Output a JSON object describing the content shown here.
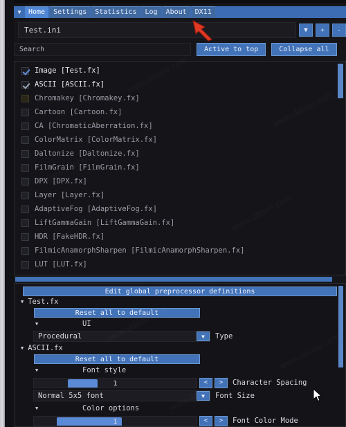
{
  "tabs": {
    "caret_icon": "chevron-down-icon",
    "items": [
      {
        "label": "Home",
        "active": true
      },
      {
        "label": "Settings",
        "active": false
      },
      {
        "label": "Statistics",
        "active": false
      },
      {
        "label": "Log",
        "active": false
      },
      {
        "label": "About",
        "active": false
      },
      {
        "label": "DX11",
        "active": false
      }
    ]
  },
  "preset": {
    "value": "Test.ini",
    "dropdown_icon": "chevron-down-icon",
    "add_label": "+",
    "remove_label": "-"
  },
  "search": {
    "placeholder": "Search",
    "value": "",
    "active_to_top_label": "Active to top",
    "collapse_all_label": "Collapse all"
  },
  "technique_list": {
    "items": [
      {
        "label": "Image [Test.fx]",
        "checked": true,
        "enabled": true,
        "swatch": "none"
      },
      {
        "label": "ASCII [ASCII.fx]",
        "checked": true,
        "enabled": true,
        "swatch": "dim"
      },
      {
        "label": "Chromakey [Chromakey.fx]",
        "checked": false,
        "enabled": false,
        "swatch": "olive"
      },
      {
        "label": "Cartoon [Cartoon.fx]",
        "checked": false,
        "enabled": false,
        "swatch": "none"
      },
      {
        "label": "CA [ChromaticAberration.fx]",
        "checked": false,
        "enabled": false,
        "swatch": "none"
      },
      {
        "label": "ColorMatrix [ColorMatrix.fx]",
        "checked": false,
        "enabled": false,
        "swatch": "none"
      },
      {
        "label": "Daltonize [Daltonize.fx]",
        "checked": false,
        "enabled": false,
        "swatch": "none"
      },
      {
        "label": "FilmGrain [FilmGrain.fx]",
        "checked": false,
        "enabled": false,
        "swatch": "none"
      },
      {
        "label": "DPX [DPX.fx]",
        "checked": false,
        "enabled": false,
        "swatch": "none"
      },
      {
        "label": "Layer [Layer.fx]",
        "checked": false,
        "enabled": false,
        "swatch": "none"
      },
      {
        "label": "AdaptiveFog [AdaptiveFog.fx]",
        "checked": false,
        "enabled": false,
        "swatch": "none"
      },
      {
        "label": "LiftGammaGain [LiftGammaGain.fx]",
        "checked": false,
        "enabled": false,
        "swatch": "none"
      },
      {
        "label": "HDR [FakeHDR.fx]",
        "checked": false,
        "enabled": false,
        "swatch": "none"
      },
      {
        "label": "FilmicAnamorphSharpen [FilmicAnamorphSharpen.fx]",
        "checked": false,
        "enabled": false,
        "swatch": "none"
      },
      {
        "label": "LUT [LUT.fx]",
        "checked": false,
        "enabled": false,
        "swatch": "none"
      }
    ]
  },
  "settings_panel": {
    "global_button_label": "Edit global preprocessor definitions",
    "sections": [
      {
        "title": "Test.fx",
        "caret_icon": "caret-down-icon",
        "reset_label": "Reset all to default",
        "group_label": "UI",
        "group_caret_icon": "caret-down-icon",
        "combo_value": "Procedural",
        "combo_label": "Type",
        "combo_arrow_icon": "chevron-down-icon"
      },
      {
        "title": "ASCII.fx",
        "caret_icon": "caret-down-icon",
        "reset_label": "Reset all to default",
        "group_label": "Font style",
        "group_caret_icon": "caret-down-icon",
        "slider_value": "1",
        "slider_label": "Character Spacing",
        "slider_fill_percent": 30,
        "slider_handle_width_percent": 18,
        "dec_label": "<",
        "inc_label": ">",
        "combo_value": "Normal 5x5 font",
        "combo_label": "Font Size",
        "combo_arrow_icon": "chevron-down-icon",
        "group2_label": "Color options",
        "group2_caret_icon": "caret-down-icon",
        "slider2_value": "1",
        "slider2_label": "Font Color Mode",
        "slider2_fill_percent": 34,
        "slider2_handle_width_percent": 40,
        "dec2_label": "<",
        "inc2_label": ">"
      }
    ]
  },
  "annotations": {
    "red_arrow_icon": "red-arrow-annotation",
    "cursor_icon": "mouse-pointer-icon"
  },
  "watermark": {
    "text": "www.ddooo.com"
  },
  "colors": {
    "accent_blue": "#4272b8",
    "active_tab": "#4f86d6",
    "panel_bg": "#151519",
    "window_bg": "#16161a",
    "slider_blue": "#5b8ad6",
    "annotation_red": "#e03a24"
  }
}
